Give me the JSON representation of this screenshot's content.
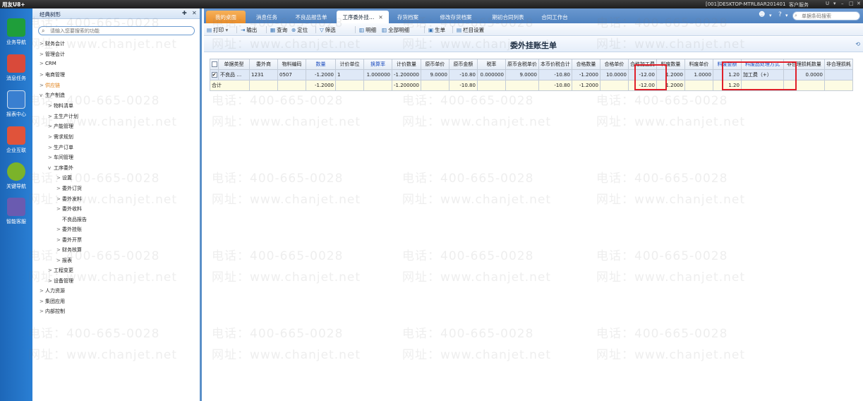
{
  "topbar": {
    "brand": "用友U8+",
    "session": "[001]DESKTOP-MTRL8AR201401",
    "service": "客户服务",
    "help_u": "U",
    "more": "▾",
    "win_min": "–",
    "win_max": "□",
    "win_close": "✕"
  },
  "leftnav": [
    {
      "label": "业务导航",
      "icon": "business-nav-icon",
      "color": "#1f9e3a"
    },
    {
      "label": "消息任务",
      "icon": "message-task-icon",
      "color": "#d94a3a"
    },
    {
      "label": "报表中心",
      "icon": "report-center-icon",
      "color": "#3a7fd0"
    },
    {
      "label": "企业互联",
      "icon": "enterprise-link-icon",
      "color": "#e0533a"
    },
    {
      "label": "关键导航",
      "icon": "key-nav-icon",
      "color": "#7bb32a"
    },
    {
      "label": "智能客服",
      "icon": "smart-service-icon",
      "color": "#6a5bb0"
    }
  ],
  "tree": {
    "title": "经典树形",
    "pin": "✚",
    "close": "✕",
    "search_placeholder": "请输入您要搜索的功能",
    "nodes": [
      {
        "label": "财务会计",
        "arrow": ">"
      },
      {
        "label": "管理会计",
        "arrow": ">"
      },
      {
        "label": "CRM",
        "arrow": ">"
      },
      {
        "label": "电商管理",
        "arrow": ">"
      },
      {
        "label": "供应链",
        "arrow": ">",
        "highlight": true
      },
      {
        "label": "生产制造",
        "arrow": "v"
      },
      {
        "label": "物料清单",
        "arrow": ">"
      },
      {
        "label": "主生产计划",
        "arrow": ">"
      },
      {
        "label": "产能管理",
        "arrow": ">"
      },
      {
        "label": "需求规划",
        "arrow": ">"
      },
      {
        "label": "生产订单",
        "arrow": ">"
      },
      {
        "label": "车间管理",
        "arrow": ">"
      },
      {
        "label": "工序委外",
        "arrow": "v"
      },
      {
        "label": "设置",
        "arrow": ">"
      },
      {
        "label": "委外订货",
        "arrow": ">"
      },
      {
        "label": "委外发料",
        "arrow": ">"
      },
      {
        "label": "委外收料",
        "arrow": ">"
      },
      {
        "label": "不良品报告",
        "arrow": ""
      },
      {
        "label": "委外挂账",
        "arrow": ">"
      },
      {
        "label": "委外开票",
        "arrow": ">"
      },
      {
        "label": "财务核算",
        "arrow": ">"
      },
      {
        "label": "报表",
        "arrow": ">"
      },
      {
        "label": "工程变更",
        "arrow": ">"
      },
      {
        "label": "设备管理",
        "arrow": ">"
      },
      {
        "label": "人力资源",
        "arrow": ">"
      },
      {
        "label": "集团应用",
        "arrow": ">"
      },
      {
        "label": "内部控制",
        "arrow": ">"
      }
    ]
  },
  "tabs": [
    {
      "label": "我的桌面"
    },
    {
      "label": "消息任务"
    },
    {
      "label": "不良品报告单"
    },
    {
      "label": "工序委外挂…",
      "close": "✕"
    },
    {
      "label": "存货档案"
    },
    {
      "label": "修改存货档案"
    },
    {
      "label": "期初合同列表"
    },
    {
      "label": "合同工作台"
    }
  ],
  "tabbar": {
    "search_placeholder": "单据条码搜索"
  },
  "toolbar": {
    "print": "打印",
    "export": "输出",
    "query": "查询",
    "locate": "定位",
    "filter": "筛选",
    "detail": "明细",
    "all_detail": "全部明细",
    "generate": "生单",
    "column_settings": "栏目设置"
  },
  "page": {
    "title": "委外挂账生单"
  },
  "table": {
    "headers": [
      "单据类型",
      "委外商",
      "物料编码",
      "数量",
      "计价单位",
      "换算率",
      "计价数量",
      "原币单价",
      "原币金额",
      "税率",
      "原币含税单价",
      "本币价税合计",
      "合格数量",
      "合格单价",
      "合格加工费",
      "料废数量",
      "料废单价",
      "料废金额",
      "料废品处理方式",
      "非合理损耗数量",
      "非合理损耗"
    ],
    "rows": [
      {
        "checked": "✔",
        "cells": [
          "不良品 …",
          "1231",
          "0507",
          "-1.2000",
          "1",
          "1.000000",
          "-1.200000",
          "9.0000",
          "-10.80",
          "0.000000",
          "9.0000",
          "-10.80",
          "-1.2000",
          "10.0000",
          "-12.00",
          "1.2000",
          "1.0000",
          "1.20",
          "加工费（+）",
          "0.0000",
          ""
        ]
      }
    ],
    "total_label": "合计",
    "totals": [
      "",
      "",
      "",
      "-1.2000",
      "",
      "",
      "-1.200000",
      "",
      "-10.80",
      "",
      "",
      "-10.80",
      "-1.2000",
      "",
      "-12.00",
      "1.2000",
      "",
      "1.20",
      "",
      "",
      ""
    ]
  },
  "watermark": {
    "phone": "电话：400-665-0028",
    "site": "网址：www.chanjet.net"
  }
}
